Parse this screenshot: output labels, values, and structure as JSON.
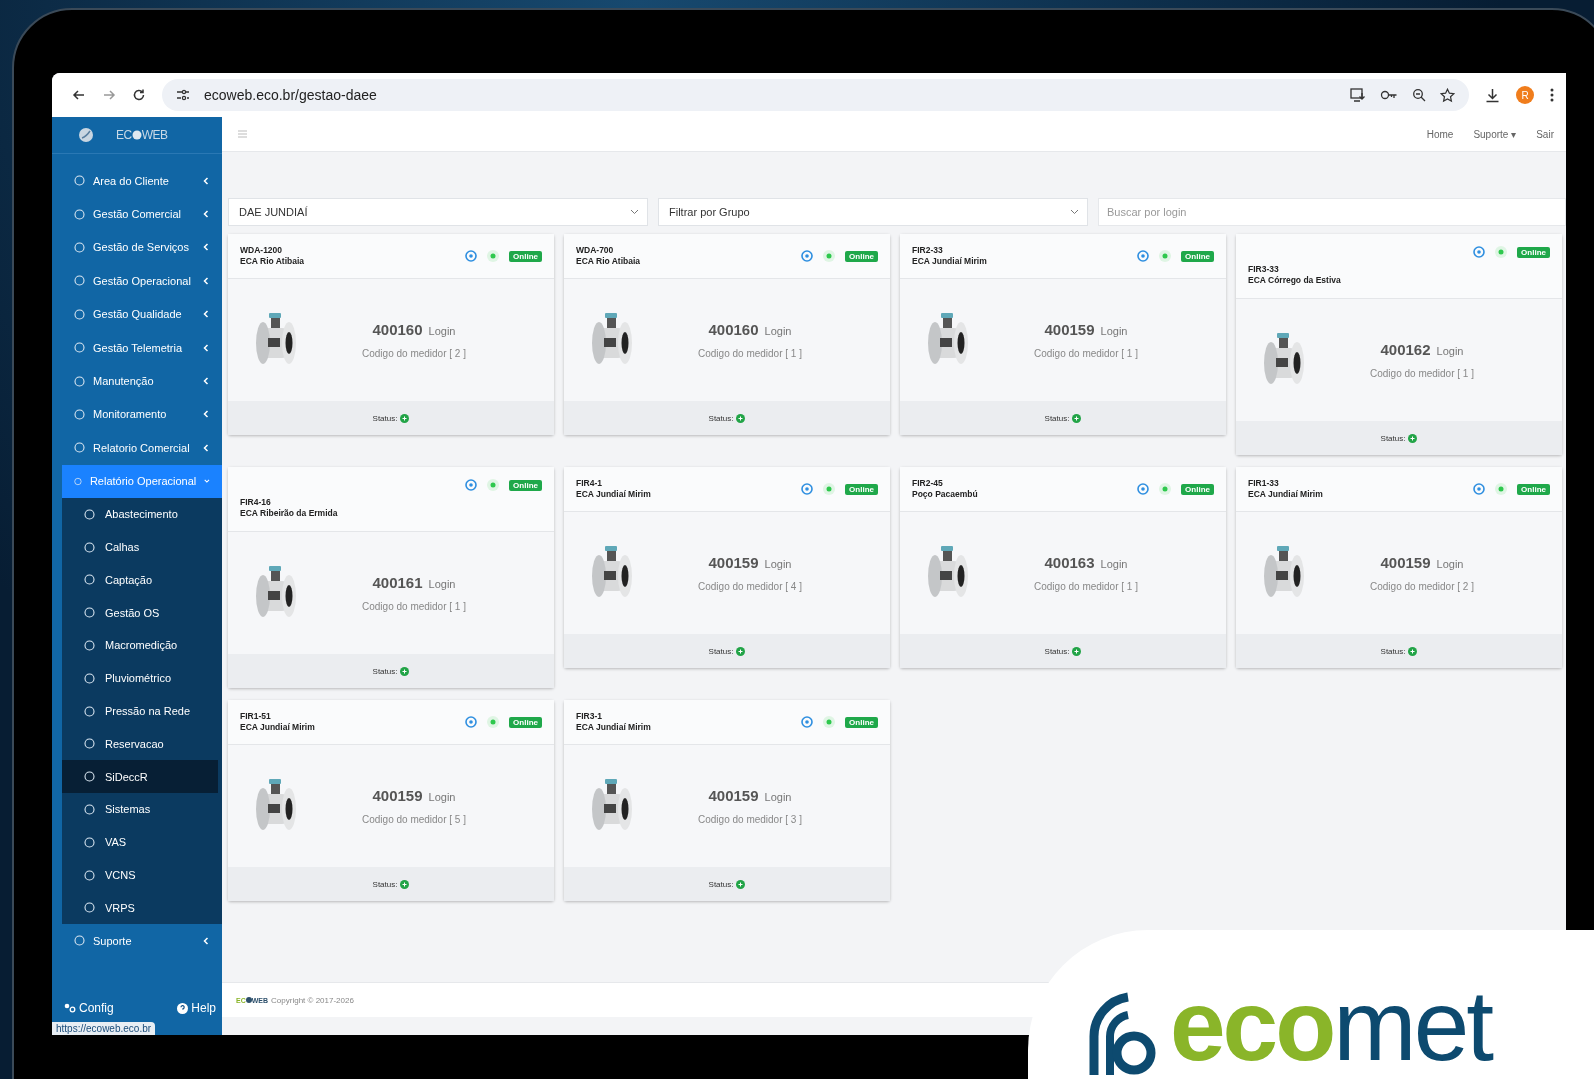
{
  "browser": {
    "url": "ecoweb.eco.br/gestao-daee",
    "avatar": "R"
  },
  "sidebar": {
    "brand": {
      "prefix": "EC",
      "suffix": "WEB"
    },
    "items": [
      {
        "label": "Area do Cliente",
        "expanded": false
      },
      {
        "label": "Gestão Comercial",
        "expanded": false
      },
      {
        "label": "Gestão de Serviços",
        "expanded": false
      },
      {
        "label": "Gestão Operacional",
        "expanded": false
      },
      {
        "label": "Gestão Qualidade",
        "expanded": false
      },
      {
        "label": "Gestão Telemetria",
        "expanded": false
      },
      {
        "label": "Manutenção",
        "expanded": false
      },
      {
        "label": "Monitoramento",
        "expanded": false
      },
      {
        "label": "Relatorio Comercial",
        "expanded": false
      },
      {
        "label": "Relatório Operacional",
        "expanded": true,
        "children": [
          {
            "label": "Abastecimento",
            "selected": false
          },
          {
            "label": "Calhas",
            "selected": false
          },
          {
            "label": "Captação",
            "selected": false
          },
          {
            "label": "Gestão OS",
            "selected": false
          },
          {
            "label": "Macromedição",
            "selected": false
          },
          {
            "label": "Pluviométrico",
            "selected": false
          },
          {
            "label": "Pressão na Rede",
            "selected": false
          },
          {
            "label": "Reservacao",
            "selected": false
          },
          {
            "label": "SiDeccR",
            "selected": true
          },
          {
            "label": "Sistemas",
            "selected": false
          },
          {
            "label": "VAS",
            "selected": false
          },
          {
            "label": "VCNS",
            "selected": false
          },
          {
            "label": "VRPS",
            "selected": false
          }
        ]
      },
      {
        "label": "Suporte",
        "expanded": false
      }
    ],
    "footer": {
      "config": "Config",
      "help": "Help"
    },
    "status_url": "https://ecoweb.eco.br"
  },
  "header": {
    "links": [
      "Home",
      "Suporte ▾",
      "Sair"
    ]
  },
  "filters": {
    "unit": "DAE JUNDIAÍ",
    "group": "Filtrar por Grupo",
    "search_placeholder": "Buscar por login"
  },
  "cards": [
    {
      "code": "WDA-1200",
      "station": "ECA Rio Atibaia",
      "login": "400160",
      "login_label": "Login",
      "meter": "Codigo do medidor [ 2 ]",
      "badge": "Online",
      "status_label": "Status:",
      "kind": "inline"
    },
    {
      "code": "WDA-700",
      "station": "ECA Rio Atibaia",
      "login": "400160",
      "login_label": "Login",
      "meter": "Codigo do medidor [ 1 ]",
      "badge": "Online",
      "status_label": "Status:",
      "kind": "inline"
    },
    {
      "code": "FIR2-33",
      "station": "ECA Jundiaí Mirim",
      "login": "400159",
      "login_label": "Login",
      "meter": "Codigo do medidor [ 1 ]",
      "badge": "Online",
      "status_label": "Status:",
      "kind": "inline"
    },
    {
      "code": "FIR3-33",
      "station": "ECA Córrego da Estiva",
      "login": "400162",
      "login_label": "Login",
      "meter": "Codigo do medidor [ 1 ]",
      "badge": "Online",
      "status_label": "Status:",
      "kind": "stacked"
    },
    {
      "code": "FIR4-16",
      "station": "ECA Ribeirão da Ermida",
      "login": "400161",
      "login_label": "Login",
      "meter": "Codigo do medidor [ 1 ]",
      "badge": "Online",
      "status_label": "Status:",
      "kind": "stacked"
    },
    {
      "code": "FIR4-1",
      "station": "ECA Jundiaí Mirim",
      "login": "400159",
      "login_label": "Login",
      "meter": "Codigo do medidor [ 4 ]",
      "badge": "Online",
      "status_label": "Status:",
      "kind": "inline"
    },
    {
      "code": "FIR2-45",
      "station": "Poço Pacaembú",
      "login": "400163",
      "login_label": "Login",
      "meter": "Codigo do medidor [ 1 ]",
      "badge": "Online",
      "status_label": "Status:",
      "kind": "inline"
    },
    {
      "code": "FIR1-33",
      "station": "ECA Jundiaí Mirim",
      "login": "400159",
      "login_label": "Login",
      "meter": "Codigo do medidor [ 2 ]",
      "badge": "Online",
      "status_label": "Status:",
      "kind": "inline"
    },
    {
      "code": "FIR1-51",
      "station": "ECA Jundiaí Mirim",
      "login": "400159",
      "login_label": "Login",
      "meter": "Codigo do medidor [ 5 ]",
      "badge": "Online",
      "status_label": "Status:",
      "kind": "inline"
    },
    {
      "code": "FIR3-1",
      "station": "ECA Jundiaí Mirim",
      "login": "400159",
      "login_label": "Login",
      "meter": "Codigo do medidor [ 3 ]",
      "badge": "Online",
      "status_label": "Status:",
      "kind": "inline"
    }
  ],
  "footer": {
    "brand": {
      "prefix": "EC",
      "suffix": "WEB"
    },
    "copyright": "Copyright © 2017-2026"
  },
  "overlay_logo": {
    "part_1": "eco",
    "part_2": "met"
  }
}
